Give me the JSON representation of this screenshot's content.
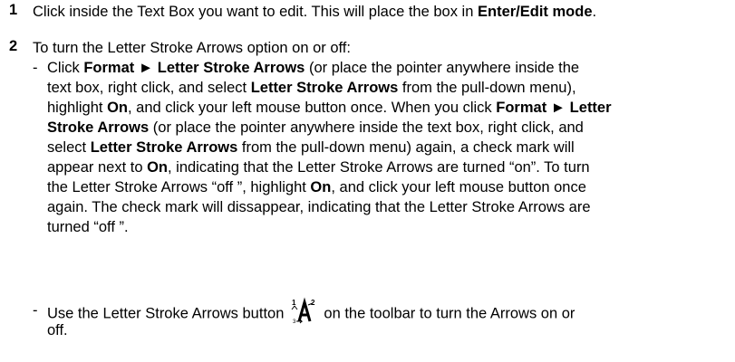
{
  "step1": {
    "number": "1",
    "text_a": "Click inside the Text Box you want to edit.  This will place the box in ",
    "text_b": "Enter/Edit mode",
    "text_c": "."
  },
  "step2": {
    "number": "2",
    "intro": "To turn the Letter Stroke Arrows option on or off:",
    "bullet_dash": "-",
    "bullet1_lines": [
      [
        [
          "Click ",
          false
        ],
        [
          "Format ► Letter Stroke Arrows",
          true
        ],
        [
          " (or place the pointer anywhere inside the",
          false
        ]
      ],
      [
        [
          "text box, right click, and select ",
          false
        ],
        [
          "Letter Stroke Arrows",
          true
        ],
        [
          " from the pull-down menu),",
          false
        ]
      ],
      [
        [
          "highlight ",
          false
        ],
        [
          "On",
          true
        ],
        [
          ", and click your left mouse button once. When you click ",
          false
        ],
        [
          "Format ► Letter",
          true
        ]
      ],
      [
        [
          "Stroke Arrows",
          true
        ],
        [
          " (or place the pointer anywhere inside the text box, right click, and",
          false
        ]
      ],
      [
        [
          "select ",
          false
        ],
        [
          "Letter Stroke Arrows",
          true
        ],
        [
          " from the pull-down menu) again, a check mark will",
          false
        ]
      ],
      [
        [
          "appear next to ",
          false
        ],
        [
          "On",
          true
        ],
        [
          ", indicating that the Letter Stroke Arrows are turned “on”.  To turn",
          false
        ]
      ],
      [
        [
          "the Letter Stroke Arrows “off ”, highlight ",
          false
        ],
        [
          "On",
          true
        ],
        [
          ", and click your left mouse button once",
          false
        ]
      ],
      [
        [
          "again.  The check mark will dissappear, indicating that the Letter Stroke Arrows are",
          false
        ]
      ],
      [
        [
          "turned “off ”.",
          false
        ]
      ]
    ],
    "bullet2_a": "Use the Letter Stroke Arrows button",
    "bullet2_b": "on the toolbar to turn the Arrows on or",
    "bullet2_c": "off.",
    "icon": "letter-stroke-arrows-icon"
  }
}
